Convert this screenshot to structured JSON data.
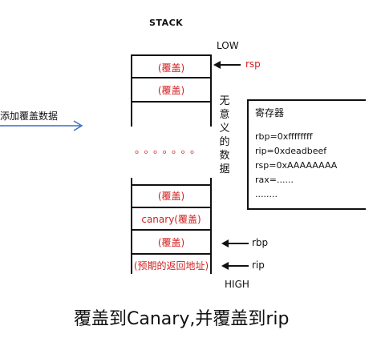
{
  "stack_title": "STACK",
  "low_label": "LOW",
  "high_label": "HIGH",
  "cells": {
    "top1": "(覆盖)",
    "top2": "(覆盖)",
    "bottom1": "(覆盖)",
    "canary": "canary(覆盖)",
    "bottom3": "(覆盖)",
    "ret": "(预期的返回地址)"
  },
  "dots": "。。。。。。。",
  "pointer_labels": {
    "rsp": "rsp",
    "rbp": "rbp",
    "rip": "rip"
  },
  "vertical_text": "无意义的数据",
  "registers": {
    "title": "寄存器",
    "lines": [
      "rbp=0xffffffff",
      "rip=0xdeadbeef",
      "rsp=0xAAAAAAAA",
      "rax=......",
      "........"
    ]
  },
  "left_label": "添加覆盖数据",
  "caption": "覆盖到Canary,并覆盖到rip",
  "colors": {
    "accent": "#d21f1f",
    "arrow_blue": "#3a6fc4",
    "ink": "#111111"
  }
}
